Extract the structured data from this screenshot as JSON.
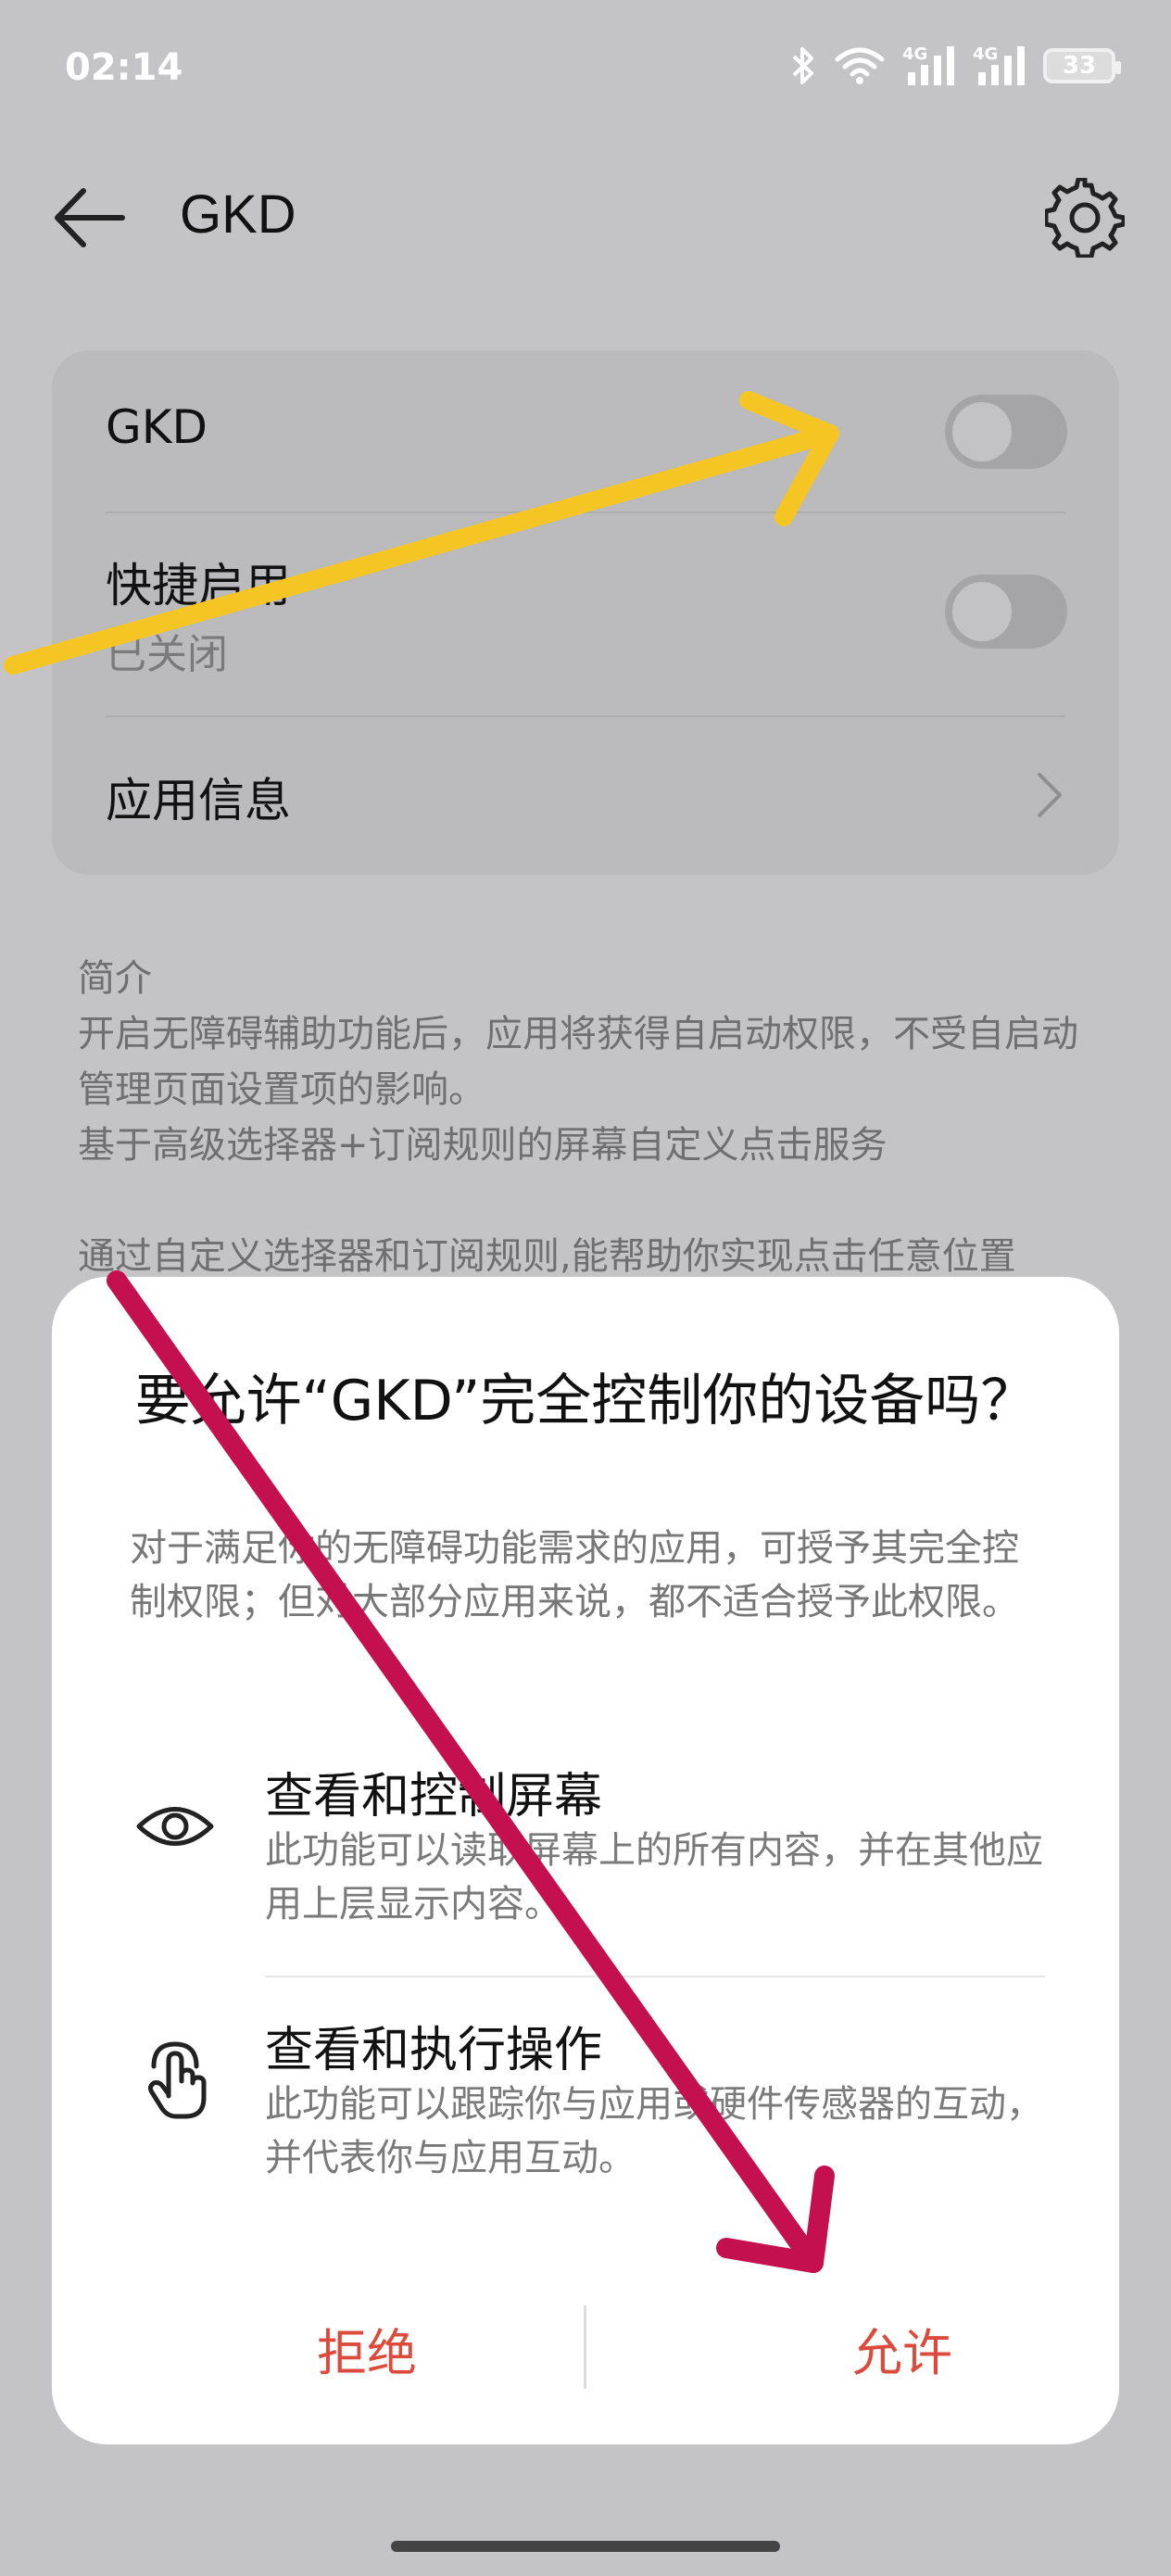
{
  "status_bar": {
    "time": "02:14",
    "battery": "33",
    "network_1": "4G",
    "network_2": "4G"
  },
  "app_bar": {
    "title": "GKD"
  },
  "settings_card": {
    "gkd_toggle_label": "GKD",
    "shortcut_label": "快捷启用",
    "shortcut_status": "已关闭",
    "app_info_label": "应用信息"
  },
  "intro": {
    "heading": "简介",
    "line1": "开启无障碍辅助功能后，应用将获得自启动权限，不受自启动管理页面设置项的影响。",
    "line2": "基于高级选择器+订阅规则的屏幕自定义点击服务",
    "line3": "通过自定义选择器和订阅规则,能帮助你实现点击任意位置"
  },
  "dialog": {
    "title": "要允许“GKD”完全控制你的设备吗？",
    "description": "对于满足你的无障碍功能需求的应用，可授予其完全控制权限；但对大部分应用来说，都不适合授予此权限。",
    "permissions": [
      {
        "title": "查看和控制屏幕",
        "description": "此功能可以读取屏幕上的所有内容，并在其他应用上层显示内容。",
        "icon": "eye-icon"
      },
      {
        "title": "查看和执行操作",
        "description": "此功能可以跟踪你与应用或硬件传感器的互动，并代表你与应用互动。",
        "icon": "tap-hand-icon"
      }
    ],
    "deny_label": "拒绝",
    "allow_label": "允许"
  },
  "colors": {
    "accent": "#dc4a3c",
    "overlay_arrow_yellow": "#f5c623",
    "overlay_arrow_magenta": "#c4104f",
    "scrim": "#c4c4c6"
  }
}
